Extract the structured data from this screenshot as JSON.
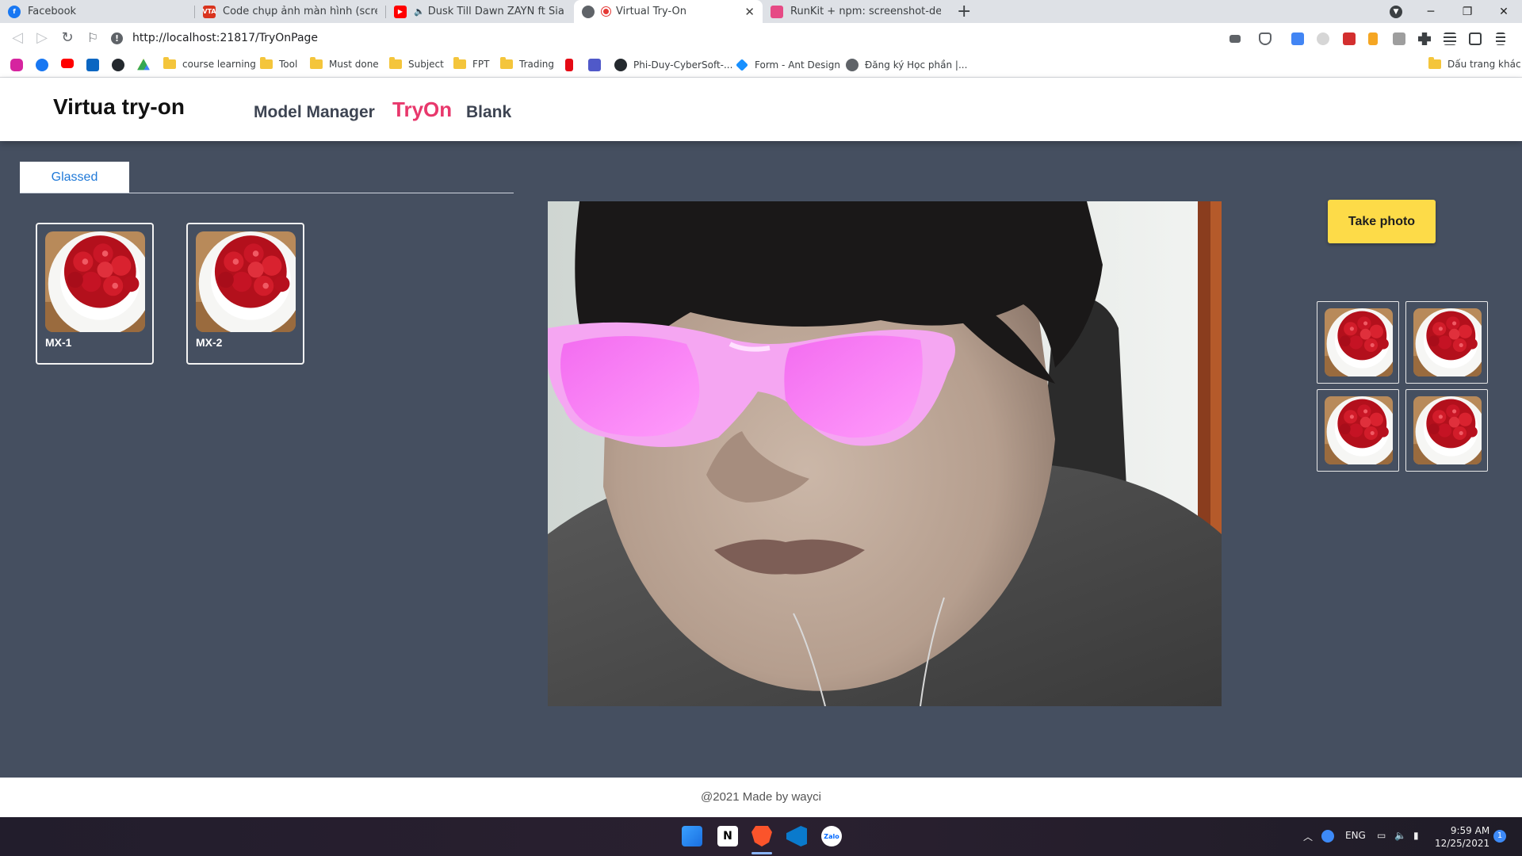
{
  "browser": {
    "tabs": [
      {
        "title": "Facebook",
        "icon": "facebook-icon",
        "color": "#1877f2"
      },
      {
        "title": "Code chụp ảnh màn hình (screenshot)",
        "icon": "vta-icon",
        "color": "#d9341e"
      },
      {
        "title": "Dusk Till Dawn ZAYN ft Sia ДбкПа",
        "icon": "youtube-icon",
        "color": "#ff0000"
      },
      {
        "title": "Virtual Try-On",
        "icon": "globe-icon",
        "color": "#5f6368",
        "active": true
      },
      {
        "title": "RunKit + npm: screenshot-desktop",
        "icon": "runkit-icon",
        "color": "#e64a85"
      }
    ],
    "address": "http://localhost:21817/TryOnPage",
    "bookmarks": [
      {
        "label": "",
        "icon": "instagram-icon",
        "color": "#d6249f"
      },
      {
        "label": "",
        "icon": "facebook-icon",
        "color": "#1877f2"
      },
      {
        "label": "",
        "icon": "youtube-icon",
        "color": "#ff0000"
      },
      {
        "label": "",
        "icon": "linkedin-icon",
        "color": "#0a66c2"
      },
      {
        "label": "",
        "icon": "github-icon",
        "color": "#24292e"
      },
      {
        "label": "",
        "icon": "google-drive-icon",
        "color": "#34a853"
      },
      {
        "label": "course learning",
        "icon": "folder-icon"
      },
      {
        "label": "Tool",
        "icon": "folder-icon"
      },
      {
        "label": "Must done",
        "icon": "folder-icon"
      },
      {
        "label": "Subject",
        "icon": "folder-icon"
      },
      {
        "label": "FPT",
        "icon": "folder-icon"
      },
      {
        "label": "Trading",
        "icon": "folder-icon"
      },
      {
        "label": "",
        "icon": "netflix-icon",
        "color": "#e50914"
      },
      {
        "label": "",
        "icon": "teams-icon",
        "color": "#5059c9"
      },
      {
        "label": "Phi-Duy-CyberSoft-...",
        "icon": "github-icon",
        "color": "#24292e"
      },
      {
        "label": "Form - Ant Design",
        "icon": "ant-design-icon",
        "color": "#1890ff"
      },
      {
        "label": "Đăng ký Học phần |...",
        "icon": "globe-icon",
        "color": "#5f6368"
      }
    ],
    "other_bookmarks": "Dấu trang khác"
  },
  "app": {
    "brand": "Virtua try-on",
    "nav": [
      {
        "label": "Model Manager",
        "active": false
      },
      {
        "label": "TryOn",
        "active": true
      },
      {
        "label": "Blank",
        "active": false
      }
    ],
    "category_tab": "Glassed",
    "models": [
      {
        "label": "MX-1"
      },
      {
        "label": "MX-2"
      }
    ],
    "take_photo_label": "Take photo",
    "captured_count": 4,
    "footer": "@2021 Made by wayci",
    "accent_color": "#e8386c",
    "button_color": "#fddb48"
  },
  "taskbar": {
    "apps": [
      "windows-start-icon",
      "notion-icon",
      "brave-icon",
      "vscode-icon",
      "zalo-icon"
    ],
    "language": "ENG",
    "time": "9:59 AM",
    "date": "12/25/2021",
    "notification_count": "1"
  }
}
